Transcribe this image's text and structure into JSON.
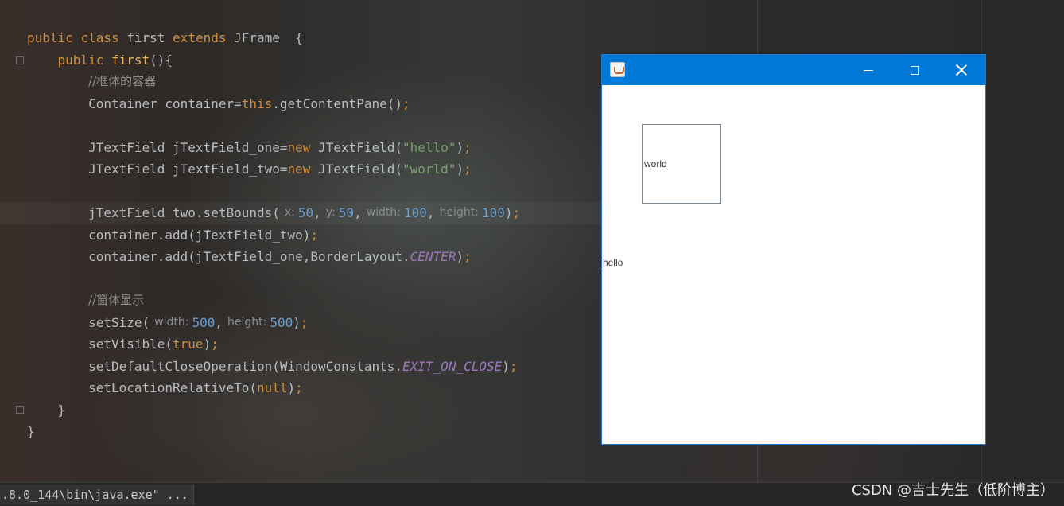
{
  "editor": {
    "lines": [
      {
        "tokens": [
          {
            "t": "public",
            "c": "kw"
          },
          {
            "t": " "
          },
          {
            "t": "class",
            "c": "kw"
          },
          {
            "t": " first "
          },
          {
            "t": "extends",
            "c": "kw"
          },
          {
            "t": " JFrame  {"
          }
        ]
      },
      {
        "tokens": [
          {
            "t": "    "
          },
          {
            "t": "public",
            "c": "kw"
          },
          {
            "t": " "
          },
          {
            "t": "first",
            "c": "fn"
          },
          {
            "t": "(){"
          }
        ]
      },
      {
        "tokens": [
          {
            "t": "        "
          },
          {
            "t": "//框体的容器",
            "c": "cm"
          }
        ]
      },
      {
        "tokens": [
          {
            "t": "        Container container="
          },
          {
            "t": "this",
            "c": "kw"
          },
          {
            "t": ".getContentPane()"
          },
          {
            "t": ";",
            "c": "kw"
          }
        ]
      },
      {
        "tokens": []
      },
      {
        "tokens": [
          {
            "t": "        JTextField jTextField_one="
          },
          {
            "t": "new",
            "c": "kw"
          },
          {
            "t": " JTextField("
          },
          {
            "t": "\"hello\"",
            "c": "str"
          },
          {
            "t": ")"
          },
          {
            "t": ";",
            "c": "kw"
          }
        ]
      },
      {
        "tokens": [
          {
            "t": "        JTextField jTextField_two="
          },
          {
            "t": "new",
            "c": "kw"
          },
          {
            "t": " JTextField("
          },
          {
            "t": "\"world\"",
            "c": "str"
          },
          {
            "t": ")"
          },
          {
            "t": ";",
            "c": "kw"
          }
        ]
      },
      {
        "tokens": []
      },
      {
        "hl": true,
        "tokens": [
          {
            "t": "        jTextField_two.setBounds("
          },
          {
            "t": "x:",
            "c": "hint"
          },
          {
            "t": "50",
            "c": "num"
          },
          {
            "t": ","
          },
          {
            "t": "y:",
            "c": "hint"
          },
          {
            "t": "50",
            "c": "num"
          },
          {
            "t": ","
          },
          {
            "t": "width:",
            "c": "hint"
          },
          {
            "t": "100",
            "c": "num"
          },
          {
            "t": ","
          },
          {
            "t": "height:",
            "c": "hint"
          },
          {
            "t": "100",
            "c": "num"
          },
          {
            "t": ")"
          },
          {
            "t": ";",
            "c": "kw"
          }
        ]
      },
      {
        "tokens": [
          {
            "t": "        container.add(jTextField_two)"
          },
          {
            "t": ";",
            "c": "kw"
          }
        ]
      },
      {
        "tokens": [
          {
            "t": "        container.add(jTextField_one,BorderLayout."
          },
          {
            "t": "CENTER",
            "c": "it"
          },
          {
            "t": ")"
          },
          {
            "t": ";",
            "c": "kw"
          }
        ]
      },
      {
        "tokens": []
      },
      {
        "tokens": [
          {
            "t": "        "
          },
          {
            "t": "//窗体显示",
            "c": "cm"
          }
        ]
      },
      {
        "tokens": [
          {
            "t": "        setSize("
          },
          {
            "t": "width:",
            "c": "hint"
          },
          {
            "t": "500",
            "c": "num"
          },
          {
            "t": ","
          },
          {
            "t": "height:",
            "c": "hint"
          },
          {
            "t": "500",
            "c": "num"
          },
          {
            "t": ")"
          },
          {
            "t": ";",
            "c": "kw"
          }
        ]
      },
      {
        "tokens": [
          {
            "t": "        setVisible("
          },
          {
            "t": "true",
            "c": "kw"
          },
          {
            "t": ")"
          },
          {
            "t": ";",
            "c": "kw"
          }
        ]
      },
      {
        "tokens": [
          {
            "t": "        setDefaultCloseOperation(WindowConstants."
          },
          {
            "t": "EXIT_ON_CLOSE",
            "c": "it"
          },
          {
            "t": ")"
          },
          {
            "t": ";",
            "c": "kw"
          }
        ]
      },
      {
        "tokens": [
          {
            "t": "        setLocationRelativeTo("
          },
          {
            "t": "null",
            "c": "kw"
          },
          {
            "t": ")"
          },
          {
            "t": ";",
            "c": "kw"
          }
        ]
      },
      {
        "tokens": [
          {
            "t": "    }"
          }
        ]
      },
      {
        "tokens": [
          {
            "t": "}"
          }
        ]
      }
    ]
  },
  "run_bar": {
    "command": ".8.0_144\\bin\\java.exe\" ..."
  },
  "watermark": "CSDN @吉士先生（低阶博主）",
  "java_window": {
    "title": "",
    "field_world": "world",
    "field_hello": "hello"
  }
}
